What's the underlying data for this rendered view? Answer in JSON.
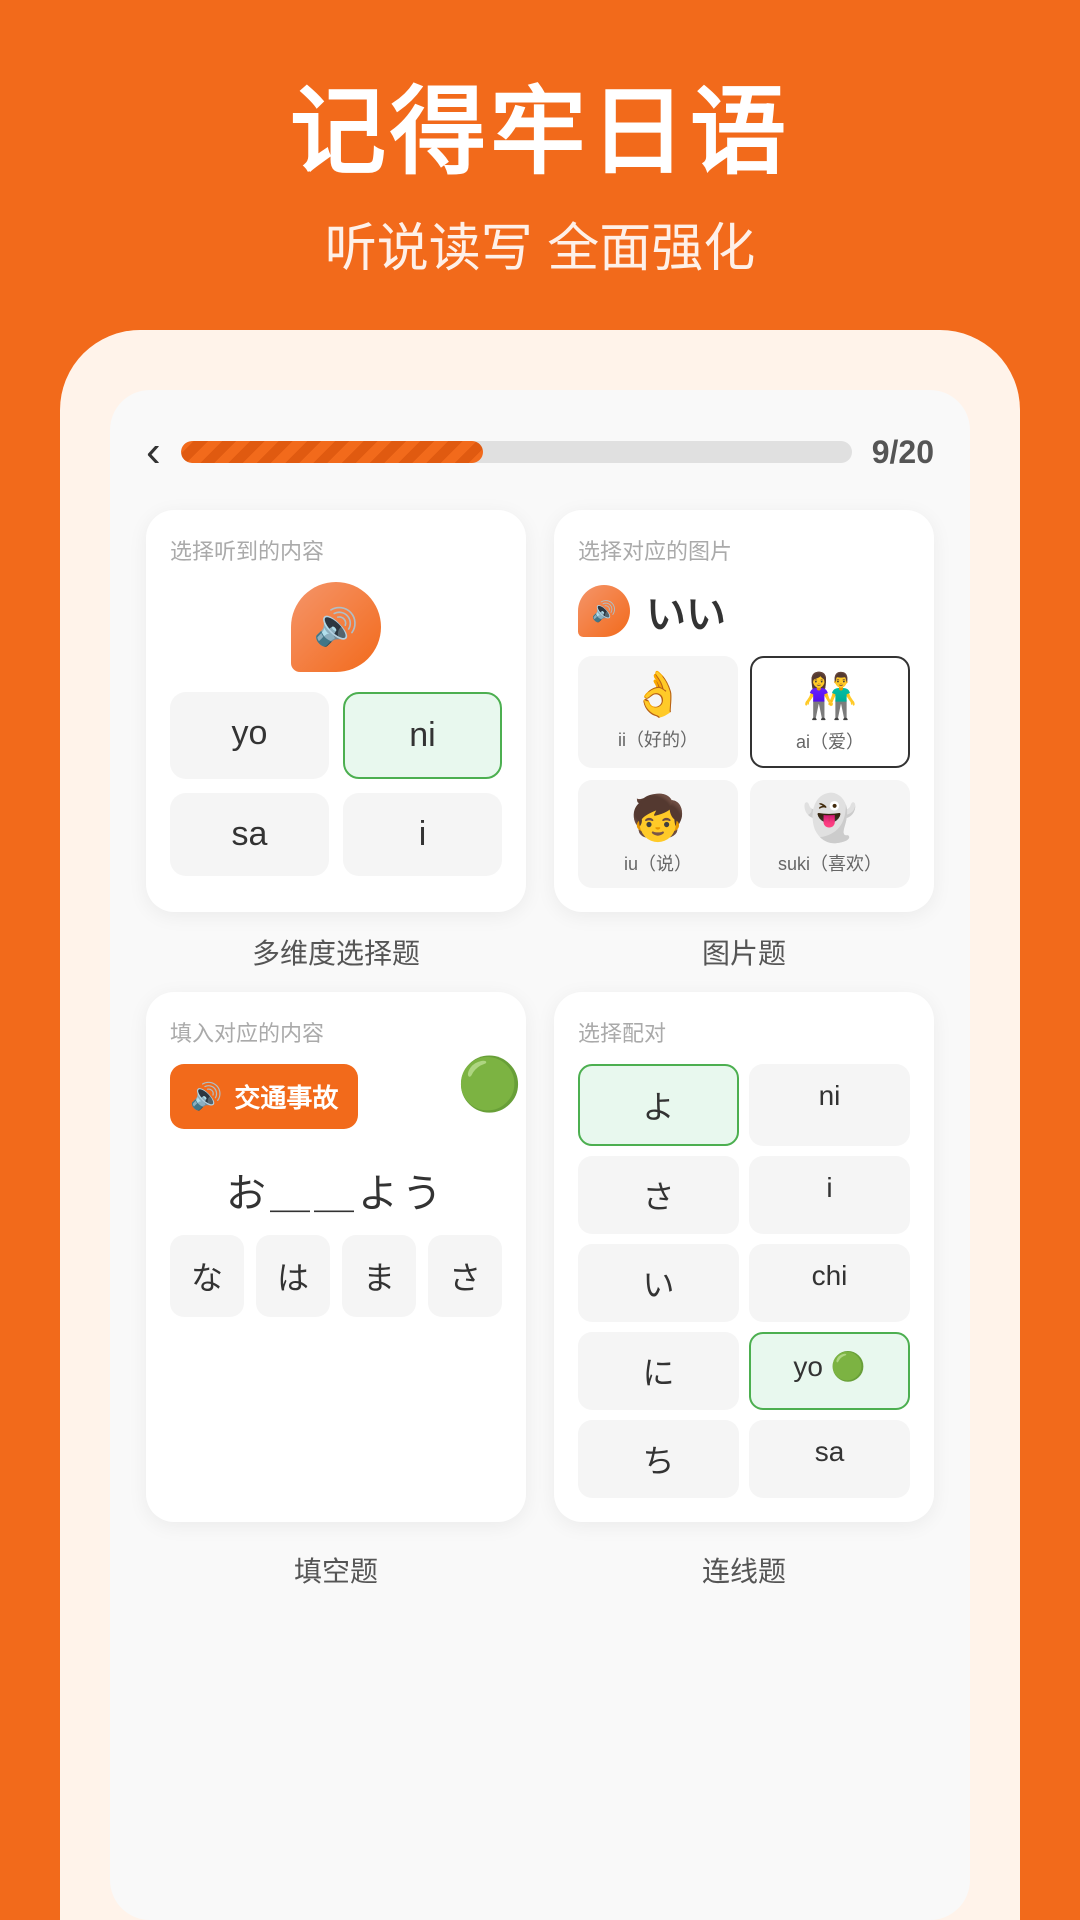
{
  "header": {
    "main_title": "记得牢日语",
    "sub_title": "听说读写 全面强化"
  },
  "progress": {
    "back_label": "‹",
    "current": "9",
    "total": "20",
    "display": "9/20",
    "percent": 45
  },
  "card1": {
    "label": "选择听到的内容",
    "type_label": "多维度选择题",
    "choices": [
      "yo",
      "ni",
      "sa",
      "i"
    ],
    "selected_index": 1
  },
  "card2": {
    "label": "选择对应的图片",
    "type_label": "图片题",
    "japanese": "いい",
    "images": [
      {
        "emoji": "👌",
        "label": "ii（好的）"
      },
      {
        "emoji": "👫",
        "label": "ai（爱）"
      },
      {
        "emoji": "🧒",
        "label": "iu（说）"
      },
      {
        "emoji": "👻",
        "label": "suki（喜欢）"
      }
    ],
    "selected_index": 1
  },
  "card3": {
    "label": "填入对应的内容",
    "type_label": "填空题",
    "phrase": "交通事故",
    "blank_display": "お＿＿よう",
    "answer_choices": [
      "な",
      "は",
      "ま",
      "さ"
    ]
  },
  "card4": {
    "label": "选择配对",
    "type_label": "连线题",
    "left_items": [
      "よ",
      "さ",
      "い",
      "に",
      "ち"
    ],
    "right_items": [
      "ni",
      "i",
      "chi",
      "yo",
      "sa"
    ],
    "selected_left": 0,
    "selected_right": 3
  }
}
